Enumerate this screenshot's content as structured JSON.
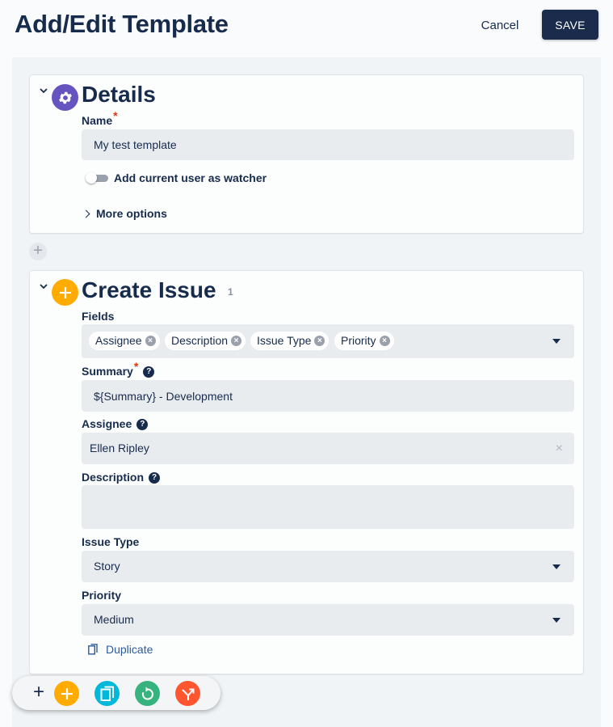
{
  "header": {
    "title": "Add/Edit Template",
    "cancel_label": "Cancel",
    "save_label": "SAVE"
  },
  "details": {
    "title": "Details",
    "icon": "gear-icon",
    "icon_color": "#6554c0",
    "name_label": "Name",
    "name_value": "My test template",
    "watcher_label": "Add current user as watcher",
    "watcher_enabled": false,
    "more_options_label": "More options"
  },
  "create_issue": {
    "title": "Create Issue",
    "icon": "plus-icon",
    "icon_color": "#ffab00",
    "count": "1",
    "fields_label": "Fields",
    "fields_chips": [
      "Assignee",
      "Description",
      "Issue Type",
      "Priority"
    ],
    "summary_label": "Summary",
    "summary_value": "${Summary} - Development",
    "assignee_label": "Assignee",
    "assignee_value": "Ellen Ripley",
    "description_label": "Description",
    "description_value": "",
    "issue_type_label": "Issue Type",
    "issue_type_value": "Story",
    "priority_label": "Priority",
    "priority_value": "Medium",
    "duplicate_label": "Duplicate"
  },
  "toolbar": {
    "buttons": [
      {
        "name": "add-step",
        "icon": "plus-icon",
        "color": "#ffab00"
      },
      {
        "name": "copy-step",
        "icon": "copy-icon",
        "color": "#00b8d9"
      },
      {
        "name": "refresh-step",
        "icon": "refresh-icon",
        "color": "#36b37e"
      },
      {
        "name": "branch-step",
        "icon": "branch-icon",
        "color": "#ff5630"
      }
    ]
  },
  "colors": {
    "primary": "#1a2b4c",
    "required": "#de350b",
    "link": "#2a5ba0"
  }
}
